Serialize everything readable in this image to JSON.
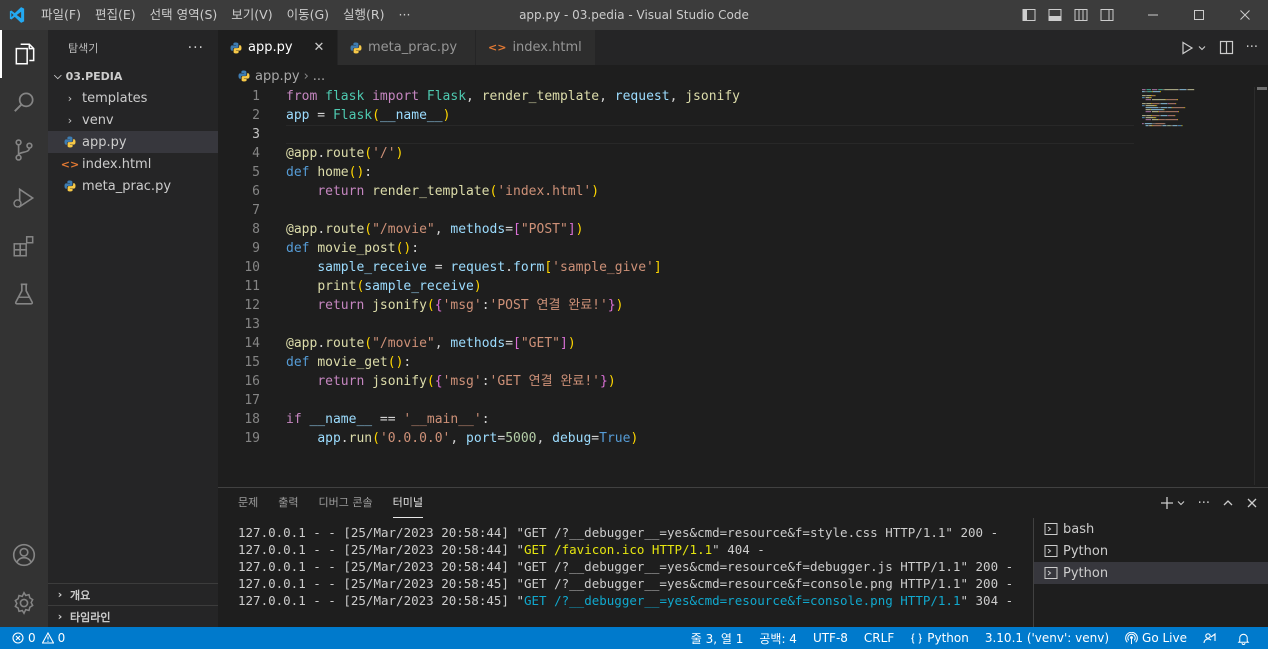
{
  "window": {
    "title": "app.py - 03.pedia - Visual Studio Code",
    "menu": [
      "파일(F)",
      "편집(E)",
      "선택 영역(S)",
      "보기(V)",
      "이동(G)",
      "실행(R)",
      "···"
    ]
  },
  "sidebar": {
    "title": "탐색기",
    "more": "···",
    "folder": "03.PEDIA",
    "items": [
      {
        "label": "templates",
        "type": "folder"
      },
      {
        "label": "venv",
        "type": "folder"
      },
      {
        "label": "app.py",
        "type": "python"
      },
      {
        "label": "index.html",
        "type": "html"
      },
      {
        "label": "meta_prac.py",
        "type": "python"
      }
    ],
    "outline": "개요",
    "timeline": "타임라인"
  },
  "tabs": [
    {
      "label": "app.py",
      "icon": "python-icon",
      "active": true,
      "close": "✕"
    },
    {
      "label": "meta_prac.py",
      "icon": "python-icon",
      "active": false
    },
    {
      "label": "index.html",
      "icon": "html-icon",
      "active": false
    }
  ],
  "breadcrumb": {
    "file": "app.py",
    "rest": "..."
  },
  "code": {
    "lines": [
      [
        [
          "kw",
          "from"
        ],
        [
          "t",
          " "
        ],
        [
          "cls",
          "flask"
        ],
        [
          "t",
          " "
        ],
        [
          "kw",
          "import"
        ],
        [
          "t",
          " "
        ],
        [
          "cls",
          "Flask"
        ],
        [
          "t",
          ", "
        ],
        [
          "fn",
          "render_template"
        ],
        [
          "t",
          ", "
        ],
        [
          "var",
          "request"
        ],
        [
          "t",
          ", "
        ],
        [
          "fn",
          "jsonify"
        ]
      ],
      [
        [
          "var",
          "app"
        ],
        [
          "t",
          " = "
        ],
        [
          "cls",
          "Flask"
        ],
        [
          "br1",
          "("
        ],
        [
          "var",
          "__name__"
        ],
        [
          "br1",
          ")"
        ]
      ],
      [],
      [
        [
          "fn",
          "@"
        ],
        [
          "fn",
          "app"
        ],
        [
          "t",
          "."
        ],
        [
          "fn",
          "route"
        ],
        [
          "br1",
          "("
        ],
        [
          "str",
          "'/'"
        ],
        [
          "br1",
          ")"
        ]
      ],
      [
        [
          "kb",
          "def"
        ],
        [
          "t",
          " "
        ],
        [
          "fn",
          "home"
        ],
        [
          "br1",
          "()"
        ],
        [
          "t",
          ":"
        ]
      ],
      [
        [
          "t",
          "    "
        ],
        [
          "kw",
          "return"
        ],
        [
          "t",
          " "
        ],
        [
          "fn",
          "render_template"
        ],
        [
          "br1",
          "("
        ],
        [
          "str",
          "'index.html'"
        ],
        [
          "br1",
          ")"
        ]
      ],
      [],
      [
        [
          "fn",
          "@"
        ],
        [
          "fn",
          "app"
        ],
        [
          "t",
          "."
        ],
        [
          "fn",
          "route"
        ],
        [
          "br1",
          "("
        ],
        [
          "str",
          "\"/movie\""
        ],
        [
          "t",
          ", "
        ],
        [
          "var",
          "methods"
        ],
        [
          "t",
          "="
        ],
        [
          "br2",
          "["
        ],
        [
          "str",
          "\"POST\""
        ],
        [
          "br2",
          "]"
        ],
        [
          "br1",
          ")"
        ]
      ],
      [
        [
          "kb",
          "def"
        ],
        [
          "t",
          " "
        ],
        [
          "fn",
          "movie_post"
        ],
        [
          "br1",
          "()"
        ],
        [
          "t",
          ":"
        ]
      ],
      [
        [
          "t",
          "    "
        ],
        [
          "var",
          "sample_receive"
        ],
        [
          "t",
          " = "
        ],
        [
          "var",
          "request"
        ],
        [
          "t",
          "."
        ],
        [
          "var",
          "form"
        ],
        [
          "br1",
          "["
        ],
        [
          "str",
          "'sample_give'"
        ],
        [
          "br1",
          "]"
        ]
      ],
      [
        [
          "t",
          "    "
        ],
        [
          "fn",
          "print"
        ],
        [
          "br1",
          "("
        ],
        [
          "var",
          "sample_receive"
        ],
        [
          "br1",
          ")"
        ]
      ],
      [
        [
          "t",
          "    "
        ],
        [
          "kw",
          "return"
        ],
        [
          "t",
          " "
        ],
        [
          "fn",
          "jsonify"
        ],
        [
          "br1",
          "("
        ],
        [
          "br2",
          "{"
        ],
        [
          "str",
          "'msg'"
        ],
        [
          "t",
          ":"
        ],
        [
          "str",
          "'POST 연결 완료!'"
        ],
        [
          "br2",
          "}"
        ],
        [
          "br1",
          ")"
        ]
      ],
      [],
      [
        [
          "fn",
          "@"
        ],
        [
          "fn",
          "app"
        ],
        [
          "t",
          "."
        ],
        [
          "fn",
          "route"
        ],
        [
          "br1",
          "("
        ],
        [
          "str",
          "\"/movie\""
        ],
        [
          "t",
          ", "
        ],
        [
          "var",
          "methods"
        ],
        [
          "t",
          "="
        ],
        [
          "br2",
          "["
        ],
        [
          "str",
          "\"GET\""
        ],
        [
          "br2",
          "]"
        ],
        [
          "br1",
          ")"
        ]
      ],
      [
        [
          "kb",
          "def"
        ],
        [
          "t",
          " "
        ],
        [
          "fn",
          "movie_get"
        ],
        [
          "br1",
          "()"
        ],
        [
          "t",
          ":"
        ]
      ],
      [
        [
          "t",
          "    "
        ],
        [
          "kw",
          "return"
        ],
        [
          "t",
          " "
        ],
        [
          "fn",
          "jsonify"
        ],
        [
          "br1",
          "("
        ],
        [
          "br2",
          "{"
        ],
        [
          "str",
          "'msg'"
        ],
        [
          "t",
          ":"
        ],
        [
          "str",
          "'GET 연결 완료!'"
        ],
        [
          "br2",
          "}"
        ],
        [
          "br1",
          ")"
        ]
      ],
      [],
      [
        [
          "kw",
          "if"
        ],
        [
          "t",
          " "
        ],
        [
          "var",
          "__name__"
        ],
        [
          "t",
          " == "
        ],
        [
          "str",
          "'__main__'"
        ],
        [
          "t",
          ":"
        ]
      ],
      [
        [
          "t",
          "    "
        ],
        [
          "var",
          "app"
        ],
        [
          "t",
          "."
        ],
        [
          "fn",
          "run"
        ],
        [
          "br1",
          "("
        ],
        [
          "str",
          "'0.0.0.0'"
        ],
        [
          "t",
          ", "
        ],
        [
          "var",
          "port"
        ],
        [
          "t",
          "="
        ],
        [
          "num",
          "5000"
        ],
        [
          "t",
          ", "
        ],
        [
          "var",
          "debug"
        ],
        [
          "t",
          "="
        ],
        [
          "kb",
          "True"
        ],
        [
          "br1",
          ")"
        ]
      ]
    ],
    "current_line": 3
  },
  "panel": {
    "tabs": [
      "문제",
      "출력",
      "디버그 콘솔",
      "터미널"
    ],
    "active_tab": 3,
    "terminal_lines": [
      [
        [
          "t",
          "127.0.0.1 - - [25/Mar/2023 20:58:44] \"GET /?__debugger__=yes&cmd=resource&f=style.css HTTP/1.1\" 200 -"
        ]
      ],
      [
        [
          "t",
          "127.0.0.1 - - [25/Mar/2023 20:58:44] \""
        ],
        [
          "y",
          "GET /favicon.ico HTTP/1.1"
        ],
        [
          "t",
          "\" 404 -"
        ]
      ],
      [
        [
          "t",
          "127.0.0.1 - - [25/Mar/2023 20:58:44] \"GET /?__debugger__=yes&cmd=resource&f=debugger.js HTTP/1.1\" 200 -"
        ]
      ],
      [
        [
          "t",
          "127.0.0.1 - - [25/Mar/2023 20:58:45] \"GET /?__debugger__=yes&cmd=resource&f=console.png HTTP/1.1\" 200 -"
        ]
      ],
      [
        [
          "t",
          "127.0.0.1 - - [25/Mar/2023 20:58:45] \""
        ],
        [
          "c",
          "GET /?__debugger__=yes&cmd=resource&f=console.png HTTP/1.1"
        ],
        [
          "t",
          "\" 304 -"
        ]
      ]
    ],
    "terminals": [
      "bash",
      "Python",
      "Python"
    ],
    "active_terminal": 2
  },
  "statusbar": {
    "errors": "0",
    "warnings": "0",
    "position": "줄 3, 열 1",
    "spaces": "공백: 4",
    "encoding": "UTF-8",
    "eol": "CRLF",
    "language": "Python",
    "interpreter": "3.10.1 ('venv': venv)",
    "golive": "Go Live"
  },
  "colors": {
    "accent": "#007acc",
    "editor_bg": "#1e1e1e",
    "sidebar_bg": "#252526",
    "activity_bg": "#333333",
    "titlebar_bg": "#3c3c3c"
  }
}
